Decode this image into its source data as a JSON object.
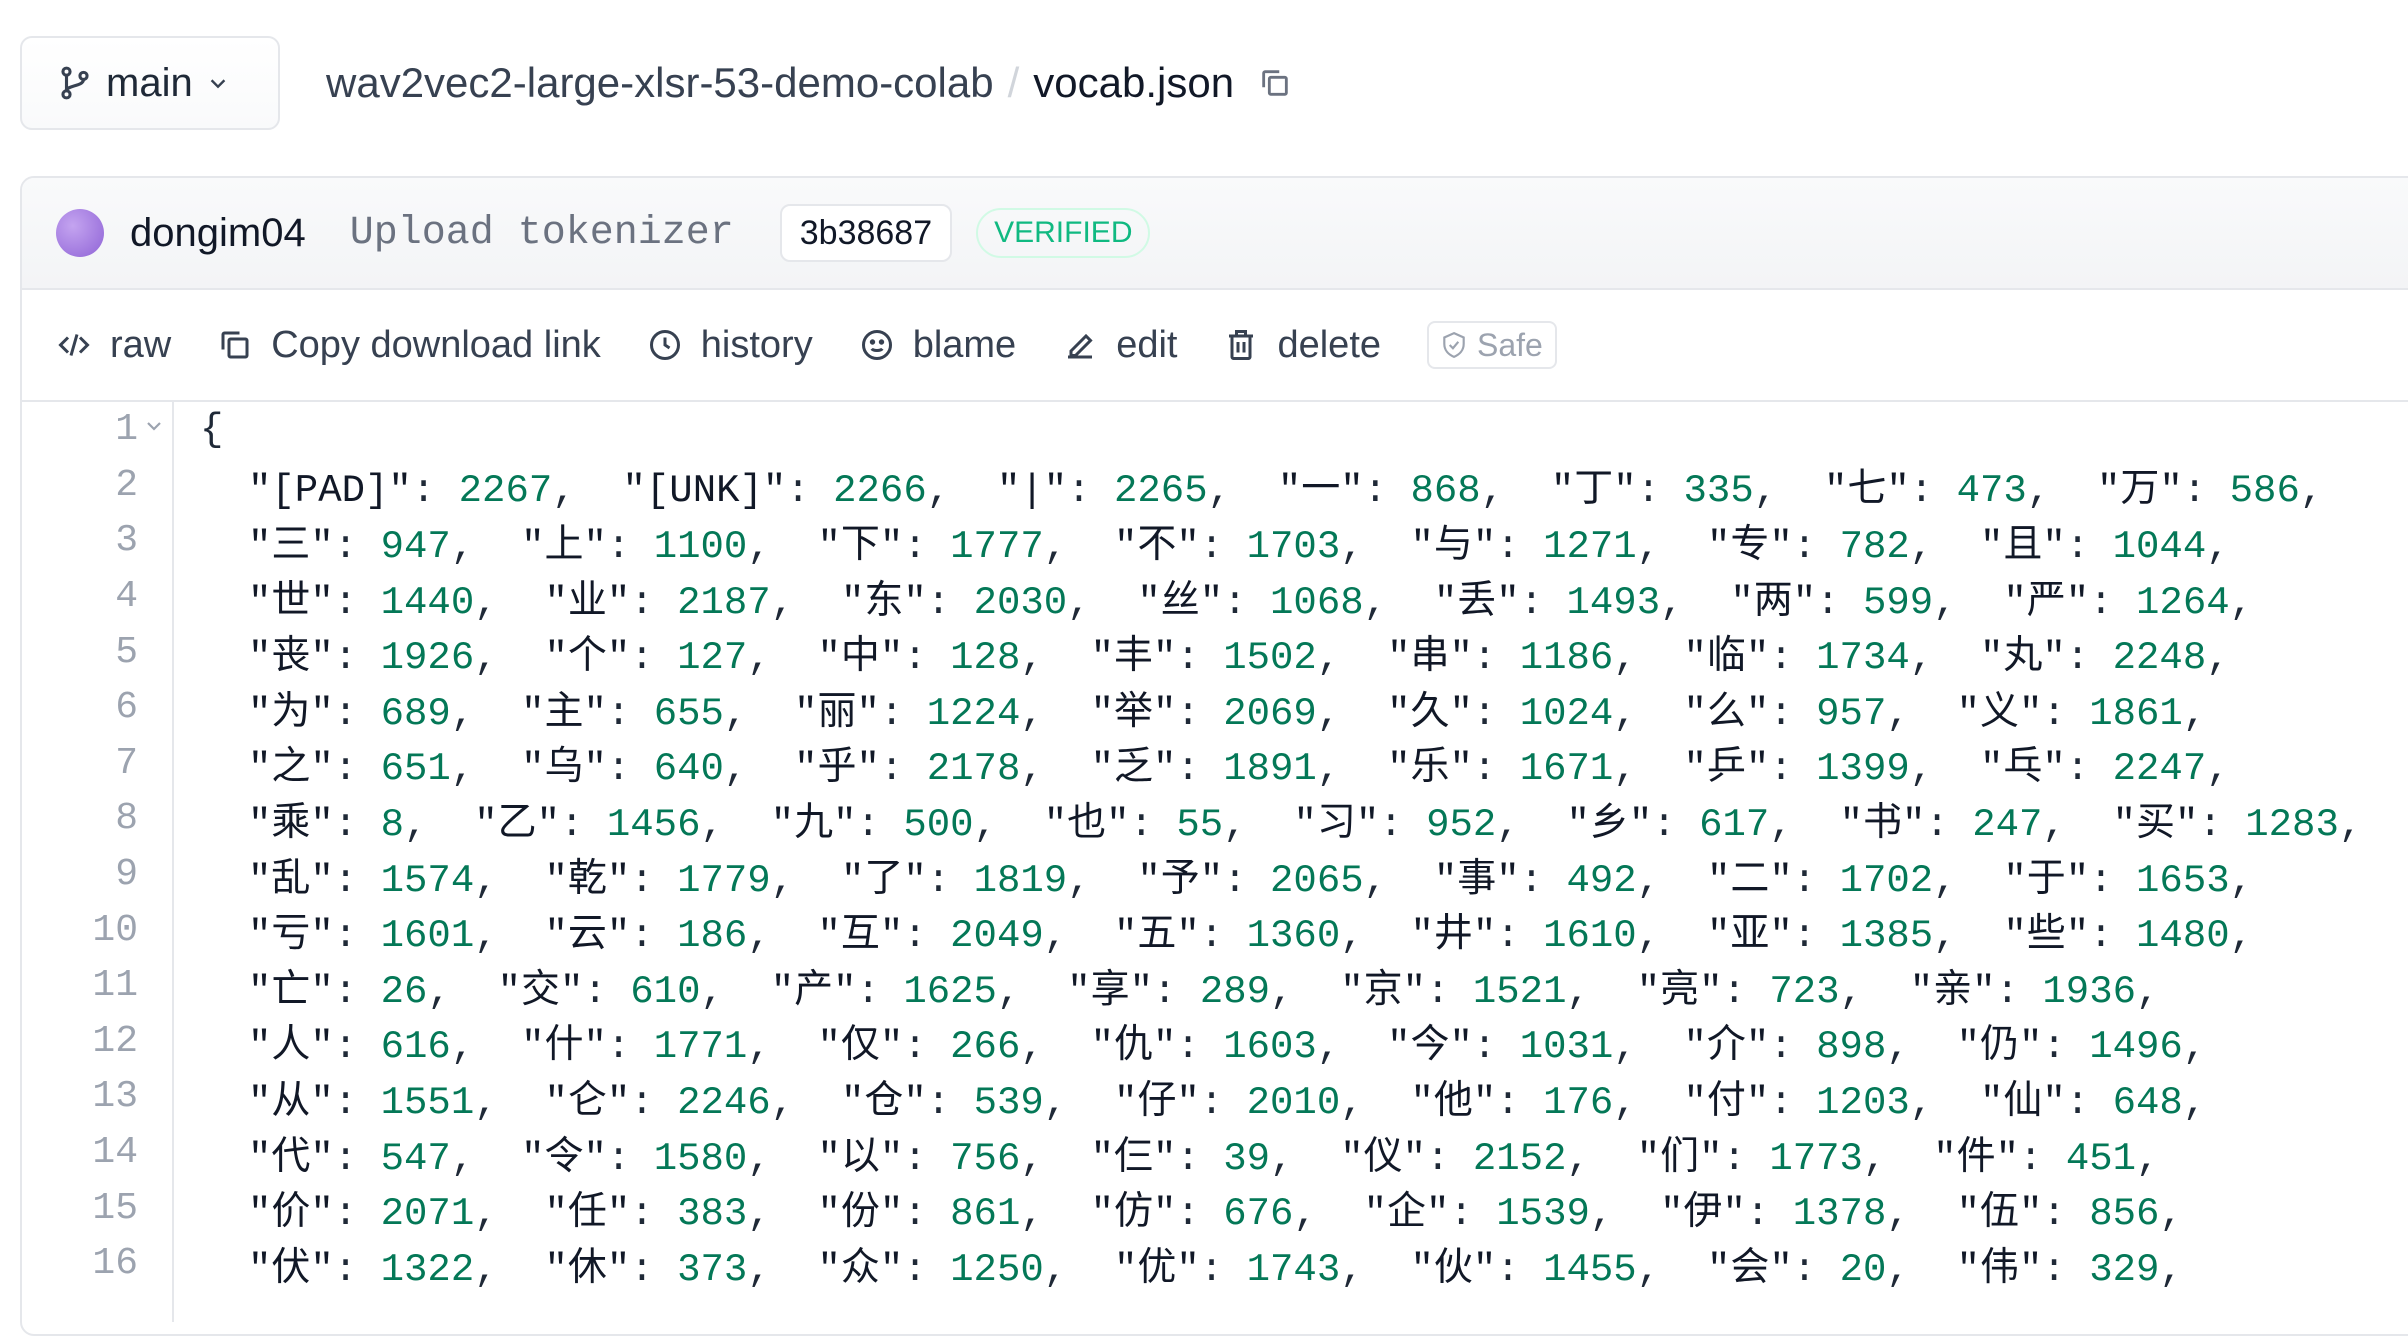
{
  "breadcrumb": {
    "branch": "main",
    "repo": "wav2vec2-large-xlsr-53-demo-colab",
    "separator": "/",
    "file": "vocab.json"
  },
  "commit": {
    "author": "dongim04",
    "message": "Upload tokenizer",
    "sha": "3b38687",
    "badge": "VERIFIED"
  },
  "actions": {
    "raw": "raw",
    "copy_link": "Copy download link",
    "history": "history",
    "blame": "blame",
    "edit": "edit",
    "delete": "delete",
    "safe": "Safe"
  },
  "icons": {
    "branch": "git-branch-icon",
    "copy_path": "copy-icon",
    "raw": "code-icon",
    "copy_link": "copy-icon",
    "history": "clock-icon",
    "blame": "smiley-icon",
    "edit": "pencil-icon",
    "delete": "trash-icon",
    "safe": "shield-icon"
  },
  "colors": {
    "value": "#047857",
    "verified": "#10b981",
    "line_number": "#9ca3af"
  },
  "code": {
    "first_line": "{",
    "lines": [
      [
        [
          "\"[PAD]\"",
          "2267"
        ],
        [
          "\"[UNK]\"",
          "2266"
        ],
        [
          "\"|\"",
          "2265"
        ],
        [
          "\"一\"",
          "868"
        ],
        [
          "\"丁\"",
          "335"
        ],
        [
          "\"七\"",
          "473"
        ],
        [
          "\"万\"",
          "586"
        ]
      ],
      [
        [
          "\"三\"",
          "947"
        ],
        [
          "\"上\"",
          "1100"
        ],
        [
          "\"下\"",
          "1777"
        ],
        [
          "\"不\"",
          "1703"
        ],
        [
          "\"与\"",
          "1271"
        ],
        [
          "\"专\"",
          "782"
        ],
        [
          "\"且\"",
          "1044"
        ]
      ],
      [
        [
          "\"世\"",
          "1440"
        ],
        [
          "\"业\"",
          "2187"
        ],
        [
          "\"东\"",
          "2030"
        ],
        [
          "\"丝\"",
          "1068"
        ],
        [
          "\"丢\"",
          "1493"
        ],
        [
          "\"两\"",
          "599"
        ],
        [
          "\"严\"",
          "1264"
        ]
      ],
      [
        [
          "\"丧\"",
          "1926"
        ],
        [
          "\"个\"",
          "127"
        ],
        [
          "\"中\"",
          "128"
        ],
        [
          "\"丰\"",
          "1502"
        ],
        [
          "\"串\"",
          "1186"
        ],
        [
          "\"临\"",
          "1734"
        ],
        [
          "\"丸\"",
          "2248"
        ]
      ],
      [
        [
          "\"为\"",
          "689"
        ],
        [
          "\"主\"",
          "655"
        ],
        [
          "\"丽\"",
          "1224"
        ],
        [
          "\"举\"",
          "2069"
        ],
        [
          "\"久\"",
          "1024"
        ],
        [
          "\"么\"",
          "957"
        ],
        [
          "\"义\"",
          "1861"
        ]
      ],
      [
        [
          "\"之\"",
          "651"
        ],
        [
          "\"乌\"",
          "640"
        ],
        [
          "\"乎\"",
          "2178"
        ],
        [
          "\"乏\"",
          "1891"
        ],
        [
          "\"乐\"",
          "1671"
        ],
        [
          "\"乒\"",
          "1399"
        ],
        [
          "\"乓\"",
          "2247"
        ]
      ],
      [
        [
          "\"乘\"",
          "8"
        ],
        [
          "\"乙\"",
          "1456"
        ],
        [
          "\"九\"",
          "500"
        ],
        [
          "\"也\"",
          "55"
        ],
        [
          "\"习\"",
          "952"
        ],
        [
          "\"乡\"",
          "617"
        ],
        [
          "\"书\"",
          "247"
        ],
        [
          "\"买\"",
          "1283"
        ]
      ],
      [
        [
          "\"乱\"",
          "1574"
        ],
        [
          "\"乾\"",
          "1779"
        ],
        [
          "\"了\"",
          "1819"
        ],
        [
          "\"予\"",
          "2065"
        ],
        [
          "\"事\"",
          "492"
        ],
        [
          "\"二\"",
          "1702"
        ],
        [
          "\"于\"",
          "1653"
        ]
      ],
      [
        [
          "\"亏\"",
          "1601"
        ],
        [
          "\"云\"",
          "186"
        ],
        [
          "\"互\"",
          "2049"
        ],
        [
          "\"五\"",
          "1360"
        ],
        [
          "\"井\"",
          "1610"
        ],
        [
          "\"亚\"",
          "1385"
        ],
        [
          "\"些\"",
          "1480"
        ]
      ],
      [
        [
          "\"亡\"",
          "26"
        ],
        [
          "\"交\"",
          "610"
        ],
        [
          "\"产\"",
          "1625"
        ],
        [
          "\"享\"",
          "289"
        ],
        [
          "\"京\"",
          "1521"
        ],
        [
          "\"亮\"",
          "723"
        ],
        [
          "\"亲\"",
          "1936"
        ]
      ],
      [
        [
          "\"人\"",
          "616"
        ],
        [
          "\"什\"",
          "1771"
        ],
        [
          "\"仅\"",
          "266"
        ],
        [
          "\"仇\"",
          "1603"
        ],
        [
          "\"今\"",
          "1031"
        ],
        [
          "\"介\"",
          "898"
        ],
        [
          "\"仍\"",
          "1496"
        ]
      ],
      [
        [
          "\"从\"",
          "1551"
        ],
        [
          "\"仑\"",
          "2246"
        ],
        [
          "\"仓\"",
          "539"
        ],
        [
          "\"仔\"",
          "2010"
        ],
        [
          "\"他\"",
          "176"
        ],
        [
          "\"付\"",
          "1203"
        ],
        [
          "\"仙\"",
          "648"
        ]
      ],
      [
        [
          "\"代\"",
          "547"
        ],
        [
          "\"令\"",
          "1580"
        ],
        [
          "\"以\"",
          "756"
        ],
        [
          "\"仨\"",
          "39"
        ],
        [
          "\"仪\"",
          "2152"
        ],
        [
          "\"们\"",
          "1773"
        ],
        [
          "\"件\"",
          "451"
        ]
      ],
      [
        [
          "\"价\"",
          "2071"
        ],
        [
          "\"任\"",
          "383"
        ],
        [
          "\"份\"",
          "861"
        ],
        [
          "\"仿\"",
          "676"
        ],
        [
          "\"企\"",
          "1539"
        ],
        [
          "\"伊\"",
          "1378"
        ],
        [
          "\"伍\"",
          "856"
        ]
      ],
      [
        [
          "\"伏\"",
          "1322"
        ],
        [
          "\"休\"",
          "373"
        ],
        [
          "\"众\"",
          "1250"
        ],
        [
          "\"优\"",
          "1743"
        ],
        [
          "\"伙\"",
          "1455"
        ],
        [
          "\"会\"",
          "20"
        ],
        [
          "\"伟\"",
          "329"
        ]
      ]
    ]
  }
}
